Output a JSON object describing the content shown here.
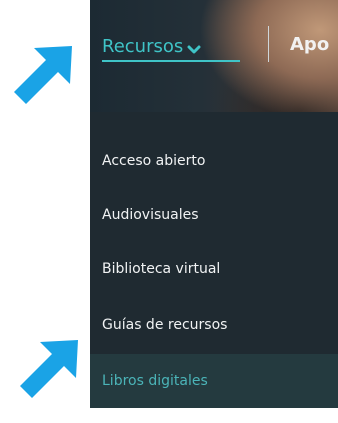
{
  "nav": {
    "current_label": "Recursos",
    "next_label": "Apo"
  },
  "menu": {
    "items": [
      {
        "label": "Acceso abierto"
      },
      {
        "label": "Audiovisuales"
      },
      {
        "label": "Biblioteca virtual"
      },
      {
        "label": "Guías de recursos"
      },
      {
        "label": "Libros digitales",
        "highlighted": true
      }
    ]
  },
  "colors": {
    "accent": "#3fc4c7",
    "arrow": "#1aa3e6",
    "menu_bg": "#1f2a31"
  },
  "icons": {
    "dropdown": "chevron-down-icon",
    "pointer": "arrow-pointer-icon"
  }
}
